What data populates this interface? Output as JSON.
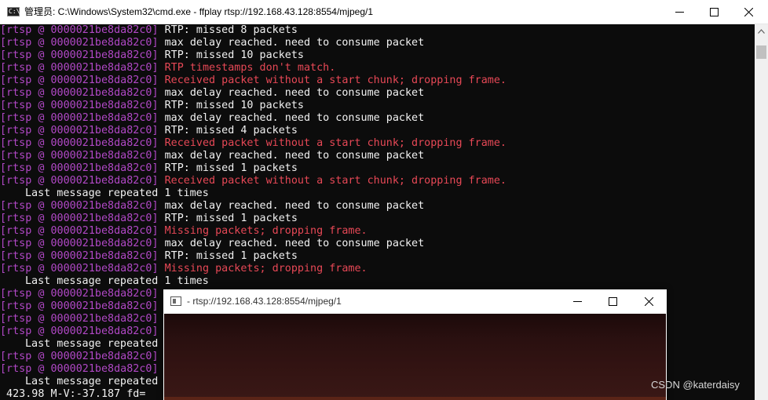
{
  "cmd": {
    "title": "管理员: C:\\Windows\\System32\\cmd.exe - ffplay  rtsp://192.168.43.128:8554/mjpeg/1",
    "icon_text": "C:\\",
    "lines": [
      {
        "prefix": "[rtsp @ 0000021be8da82c0] ",
        "msg": "RTP: missed 8 packets",
        "kind": "info"
      },
      {
        "prefix": "[rtsp @ 0000021be8da82c0] ",
        "msg": "max delay reached. need to consume packet",
        "kind": "info"
      },
      {
        "prefix": "[rtsp @ 0000021be8da82c0] ",
        "msg": "RTP: missed 10 packets",
        "kind": "info"
      },
      {
        "prefix": "[rtsp @ 0000021be8da82c0] ",
        "msg": "RTP timestamps don't match.",
        "kind": "err"
      },
      {
        "prefix": "[rtsp @ 0000021be8da82c0] ",
        "msg": "Received packet without a start chunk; dropping frame.",
        "kind": "err"
      },
      {
        "prefix": "[rtsp @ 0000021be8da82c0] ",
        "msg": "max delay reached. need to consume packet",
        "kind": "info"
      },
      {
        "prefix": "[rtsp @ 0000021be8da82c0] ",
        "msg": "RTP: missed 10 packets",
        "kind": "info"
      },
      {
        "prefix": "[rtsp @ 0000021be8da82c0] ",
        "msg": "max delay reached. need to consume packet",
        "kind": "info"
      },
      {
        "prefix": "[rtsp @ 0000021be8da82c0] ",
        "msg": "RTP: missed 4 packets",
        "kind": "info"
      },
      {
        "prefix": "[rtsp @ 0000021be8da82c0] ",
        "msg": "Received packet without a start chunk; dropping frame.",
        "kind": "err"
      },
      {
        "prefix": "[rtsp @ 0000021be8da82c0] ",
        "msg": "max delay reached. need to consume packet",
        "kind": "info"
      },
      {
        "prefix": "[rtsp @ 0000021be8da82c0] ",
        "msg": "RTP: missed 1 packets",
        "kind": "info"
      },
      {
        "prefix": "[rtsp @ 0000021be8da82c0] ",
        "msg": "Received packet without a start chunk; dropping frame.",
        "kind": "err"
      },
      {
        "prefix": "",
        "msg": "Last message repeated 1 times",
        "kind": "indent"
      },
      {
        "prefix": "[rtsp @ 0000021be8da82c0] ",
        "msg": "max delay reached. need to consume packet",
        "kind": "info"
      },
      {
        "prefix": "[rtsp @ 0000021be8da82c0] ",
        "msg": "RTP: missed 1 packets",
        "kind": "info"
      },
      {
        "prefix": "[rtsp @ 0000021be8da82c0] ",
        "msg": "Missing packets; dropping frame.",
        "kind": "err"
      },
      {
        "prefix": "[rtsp @ 0000021be8da82c0] ",
        "msg": "max delay reached. need to consume packet",
        "kind": "info"
      },
      {
        "prefix": "[rtsp @ 0000021be8da82c0] ",
        "msg": "RTP: missed 1 packets",
        "kind": "info"
      },
      {
        "prefix": "[rtsp @ 0000021be8da82c0] ",
        "msg": "Missing packets; dropping frame.",
        "kind": "err"
      },
      {
        "prefix": "",
        "msg": "Last message repeated 1 times",
        "kind": "indent"
      },
      {
        "prefix": "[rtsp @ 0000021be8da82c0]",
        "msg": "",
        "kind": "info"
      },
      {
        "prefix": "[rtsp @ 0000021be8da82c0]",
        "msg": "",
        "kind": "info"
      },
      {
        "prefix": "[rtsp @ 0000021be8da82c0]",
        "msg": "",
        "kind": "info"
      },
      {
        "prefix": "[rtsp @ 0000021be8da82c0]",
        "msg": "",
        "kind": "info"
      },
      {
        "prefix": "",
        "msg": "Last message repeated",
        "kind": "indent"
      },
      {
        "prefix": "[rtsp @ 0000021be8da82c0]",
        "msg": "",
        "kind": "info"
      },
      {
        "prefix": "[rtsp @ 0000021be8da82c0]",
        "msg": "",
        "kind": "info"
      },
      {
        "prefix": "",
        "msg": "Last message repeated",
        "kind": "indent"
      },
      {
        "prefix": "",
        "msg": " 423.98 M-V:-37.187 fd=",
        "kind": "plain"
      }
    ]
  },
  "ffplay": {
    "title": "- rtsp://192.168.43.128:8554/mjpeg/1"
  },
  "watermark": "CSDN @katerdaisy",
  "icons": {
    "minimize": "minimize-icon",
    "maximize": "maximize-icon",
    "close": "close-icon"
  },
  "colors": {
    "console_bg": "#0c0c0c",
    "prefix": "#b148c6",
    "error": "#e74856",
    "text": "#f2f2f2"
  }
}
